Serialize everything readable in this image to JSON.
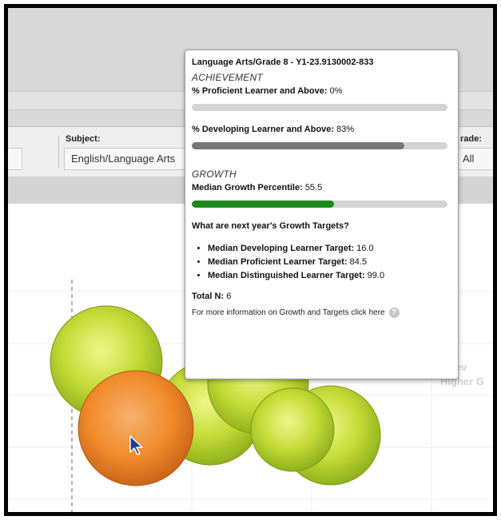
{
  "filters": {
    "subject_label": "Subject:",
    "subject_value": "English/Language Arts",
    "grade_label": "rade:",
    "grade_value": "All"
  },
  "chart": {
    "side_label_line1": "chiev",
    "side_label_line2": "Higher G",
    "bubbles": [
      {
        "name": "bubble-1",
        "color": "green"
      },
      {
        "name": "bubble-2",
        "color": "green"
      },
      {
        "name": "bubble-3",
        "color": "green"
      },
      {
        "name": "bubble-4",
        "color": "green"
      },
      {
        "name": "bubble-5",
        "color": "green"
      },
      {
        "name": "bubble-6",
        "color": "orange",
        "selected": true
      }
    ]
  },
  "tooltip": {
    "title": "Language Arts/Grade 8  - Y1-23.9130002-833",
    "achievement_heading": "ACHIEVEMENT",
    "proficient_label": "% Proficient Learner and Above:",
    "proficient_value": "0%",
    "proficient_fraction": 0.0,
    "developing_label": "% Developing Learner and Above:",
    "developing_value": "83%",
    "developing_fraction": 0.83,
    "growth_heading": "GROWTH",
    "mgp_label": "Median Growth Percentile:",
    "mgp_value": "55.5",
    "mgp_fraction": 0.555,
    "targets_question": "What are next year's Growth Targets?",
    "targets": [
      {
        "label": "Median Developing Learner Target:",
        "value": "16.0"
      },
      {
        "label": "Median Proficient Learner Target:",
        "value": "84.5"
      },
      {
        "label": "Median Distinguished Learner Target:",
        "value": "99.0"
      }
    ],
    "total_label": "Total N:",
    "total_value": "6",
    "more_info": "For more information on Growth and Targets click here",
    "help_icon": "?"
  },
  "colors": {
    "developing_bar": "#777777",
    "growth_bar": "#1e8a1e",
    "bubble_green": "#b8d42e",
    "bubble_orange": "#f08a2a"
  }
}
